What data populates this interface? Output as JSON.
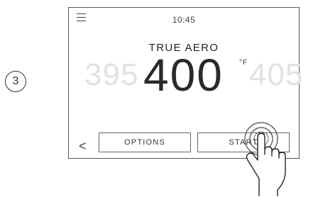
{
  "step": {
    "number": "3"
  },
  "header": {
    "time": "10:45",
    "menu_icon": "menu-icon"
  },
  "mode": {
    "title": "TRUE AERO"
  },
  "temperature": {
    "previous": "395",
    "current": "400",
    "unit": "°F",
    "next": "405"
  },
  "controls": {
    "back_icon": "chevron-left-icon",
    "back_label": "<",
    "options_label": "OPTIONS",
    "start_label": "START"
  },
  "gesture": {
    "icon": "tap-hand-icon"
  }
}
